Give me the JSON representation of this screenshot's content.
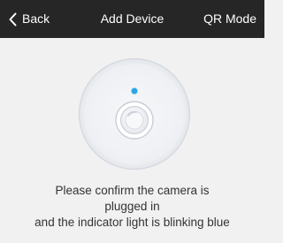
{
  "colors": {
    "header_bg": "#262626",
    "header_text": "#ffffff",
    "page_bg": "#f1f1f1",
    "indicator_light": "#2ea6e6",
    "body_text": "#333333"
  },
  "header": {
    "back_icon": "chevron-left-icon",
    "back_label": "Back",
    "title": "Add Device",
    "qr_mode_label": "QR Mode"
  },
  "illustration": {
    "icon": "camera-icon",
    "indicator_icon": "indicator-light-icon"
  },
  "instruction": {
    "line1": "Please confirm the camera is",
    "line2": "plugged in",
    "line3": "and the indicator light is blinking blue"
  }
}
